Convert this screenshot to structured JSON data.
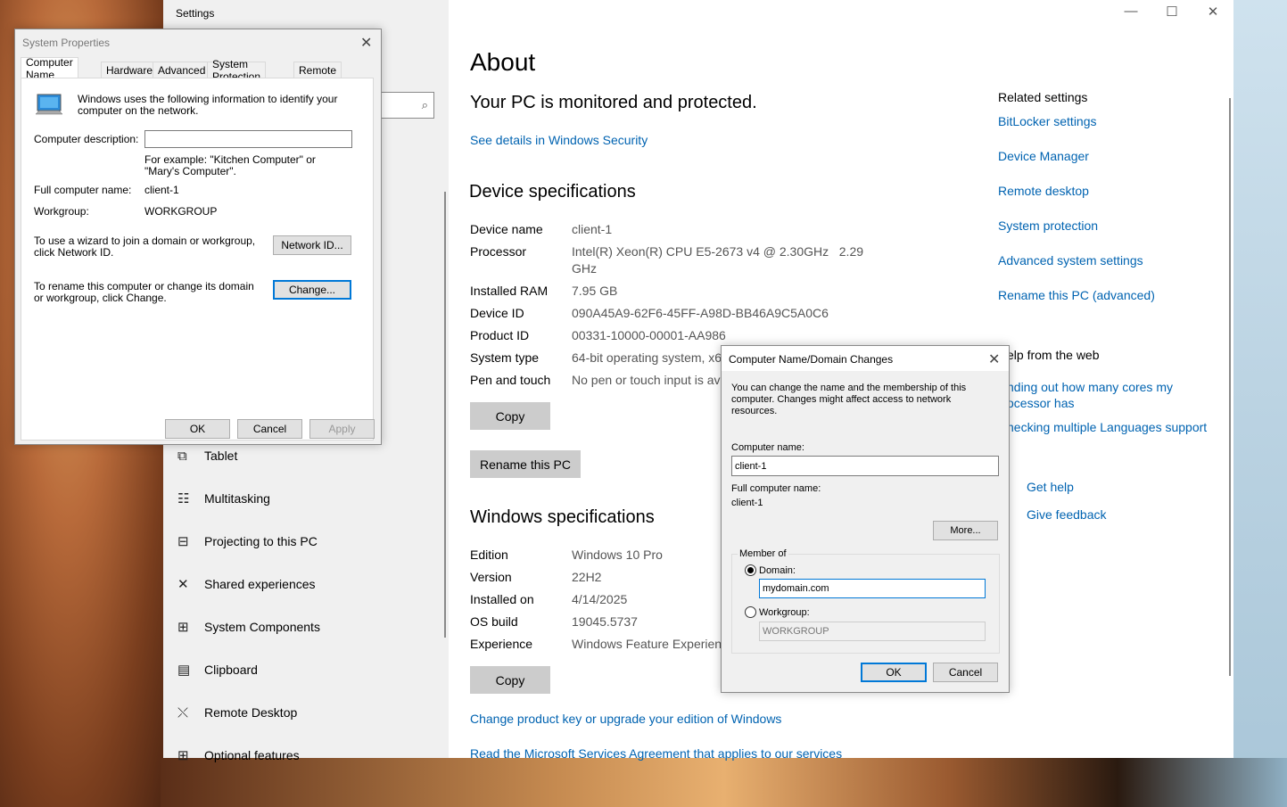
{
  "settings": {
    "title": "Settings",
    "search_icon": "search-icon",
    "nav": [
      {
        "label": "Tablet",
        "icon": "tablet-icon",
        "glyph": "⧉"
      },
      {
        "label": "Multitasking",
        "icon": "multitasking-icon",
        "glyph": "☷"
      },
      {
        "label": "Projecting to this PC",
        "icon": "projecting-icon",
        "glyph": "⊟"
      },
      {
        "label": "Shared experiences",
        "icon": "shared-experiences-icon",
        "glyph": "✕"
      },
      {
        "label": "System Components",
        "icon": "system-components-icon",
        "glyph": "⊞"
      },
      {
        "label": "Clipboard",
        "icon": "clipboard-icon",
        "glyph": "▤"
      },
      {
        "label": "Remote Desktop",
        "icon": "remote-desktop-icon",
        "glyph": "⤬"
      },
      {
        "label": "Optional features",
        "icon": "optional-features-icon",
        "glyph": "⊞"
      }
    ],
    "window_controls": {
      "minimize": "—",
      "maximize": "☐",
      "close": "✕"
    }
  },
  "about": {
    "heading": "About",
    "monitored": "Your PC is monitored and protected.",
    "security_link": "See details in Windows Security",
    "device_heading": "Device specifications",
    "device_specs": [
      {
        "key": "Device name",
        "value": "client-1"
      },
      {
        "key": "Processor",
        "value": "Intel(R) Xeon(R) CPU E5-2673 v4 @ 2.30GHz   2.29",
        "value2": "GHz"
      },
      {
        "key": "Installed RAM",
        "value": "7.95 GB"
      },
      {
        "key": "Device ID",
        "value": "090A45A9-62F6-45FF-A98D-BB46A9C5A0C6"
      },
      {
        "key": "Product ID",
        "value": "00331-10000-00001-AA986"
      },
      {
        "key": "System type",
        "value": "64-bit operating system, x6"
      },
      {
        "key": "Pen and touch",
        "value": "No pen or touch input is av"
      }
    ],
    "copy_label": "Copy",
    "rename_label": "Rename this PC",
    "windows_heading": "Windows specifications",
    "windows_specs": [
      {
        "key": "Edition",
        "value": "Windows 10 Pro"
      },
      {
        "key": "Version",
        "value": "22H2"
      },
      {
        "key": "Installed on",
        "value": "4/14/2025"
      },
      {
        "key": "OS build",
        "value": "19045.5737"
      },
      {
        "key": "Experience",
        "value": "Windows Feature Experienc"
      }
    ],
    "copy2_label": "Copy",
    "product_key_link": "Change product key or upgrade your edition of Windows",
    "msa_link": "Read the Microsoft Services Agreement that applies to our services"
  },
  "related": {
    "heading": "Related settings",
    "links": [
      "BitLocker settings",
      "Device Manager",
      "Remote desktop",
      "System protection",
      "Advanced system settings",
      "Rename this PC (advanced)"
    ],
    "help_heading": "elp from the web",
    "help_links": [
      "nding out how many cores my",
      "ocessor has",
      "hecking multiple Languages support"
    ],
    "get_help": "Get help",
    "give_feedback": "Give feedback"
  },
  "sysprops": {
    "title": "System Properties",
    "tabs": [
      "Computer Name",
      "Hardware",
      "Advanced",
      "System Protection",
      "Remote"
    ],
    "intro": "Windows uses the following information to identify your computer on the network.",
    "desc_label": "Computer description:",
    "desc_value": "",
    "example": "For example: \"Kitchen Computer\" or \"Mary's Computer\".",
    "full_name_label": "Full computer name:",
    "full_name_value": "client-1",
    "workgroup_label": "Workgroup:",
    "workgroup_value": "WORKGROUP",
    "network_text": "To use a wizard to join a domain or workgroup, click Network ID.",
    "network_btn": "Network ID...",
    "rename_text": "To rename this computer or change its domain or workgroup, click Change.",
    "change_btn": "Change...",
    "ok": "OK",
    "cancel": "Cancel",
    "apply": "Apply"
  },
  "domain_dialog": {
    "title": "Computer Name/Domain Changes",
    "intro": "You can change the name and the membership of this computer. Changes might affect access to network resources.",
    "name_label": "Computer name:",
    "name_value": "client-1",
    "full_label": "Full computer name:",
    "full_value": "client-1",
    "more_btn": "More...",
    "member_of": "Member of",
    "domain_label": "Domain:",
    "domain_value": "mydomain.com",
    "workgroup_label": "Workgroup:",
    "workgroup_value": "WORKGROUP",
    "ok": "OK",
    "cancel": "Cancel"
  }
}
